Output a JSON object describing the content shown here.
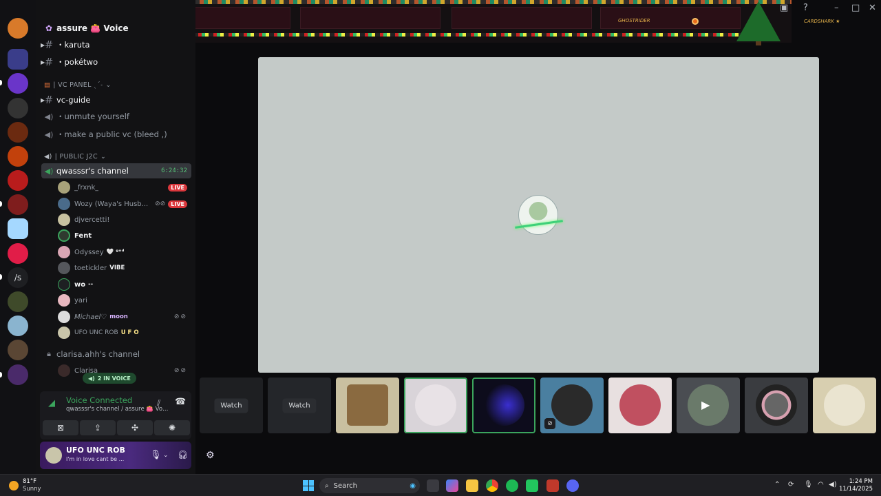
{
  "banner": {
    "user1": "GHOSTRIDER",
    "user2": "CARDSHARK ★"
  },
  "window": {
    "inbox_icon": "inbox-icon",
    "help_icon": "help-icon"
  },
  "server": {
    "name": "assure 👛 Voice"
  },
  "channels": {
    "text1": "・karuta",
    "text2": "・pokétwo",
    "cat_vc_panel": "| VC PANEL ˎˊ˗",
    "vc_guide": "vc-guide",
    "voice1": "・unmute yourself",
    "voice2": "・make a public vc (bleed ,)",
    "cat_public": "| PUBLIC J2C",
    "active_channel": "qwasssr's channel",
    "active_timer": "6:24:32",
    "second_channel": "clarisa.ahh's channel"
  },
  "users": [
    {
      "name": "_frxnk_",
      "tag": "",
      "badge": "LIVE"
    },
    {
      "name": "Wozy (Waya's Husb...",
      "tag": "",
      "badge": "LIVE",
      "muted": true
    },
    {
      "name": "djvercetti!",
      "tag": ""
    },
    {
      "name": "Fent",
      "tag": ""
    },
    {
      "name": "Odyssey",
      "tag": "🤍 ᵍᵒᵈ"
    },
    {
      "name": "toetickler",
      "tag": "VIBE"
    },
    {
      "name": "wo",
      "tag": "--"
    },
    {
      "name": "yari",
      "tag": ""
    },
    {
      "name": "Michael♡",
      "tag": "moon"
    },
    {
      "name": "UFO UNC ROB",
      "tag": "U F O"
    }
  ],
  "clarisa_user": "Clarisa",
  "in_voice": "2 IN VOICE",
  "voice_panel": {
    "status": "Voice Connected",
    "sub": "qwasssr's channel / assure 👛 Voice Chat ..."
  },
  "me": {
    "name": "UFO UNC ROB",
    "status": "I'm in love cant be ..."
  },
  "tiles": {
    "watch1": "Watch",
    "watch2": "Watch"
  },
  "taskbar": {
    "temp": "81°F",
    "cond": "Sunny",
    "search": "Search",
    "time": "1:24 PM",
    "date": "11/14/2025"
  },
  "colors": {
    "accent_green": "#3ba55d",
    "live_red": "#da373c",
    "stage_bg": "#c4cac8"
  }
}
